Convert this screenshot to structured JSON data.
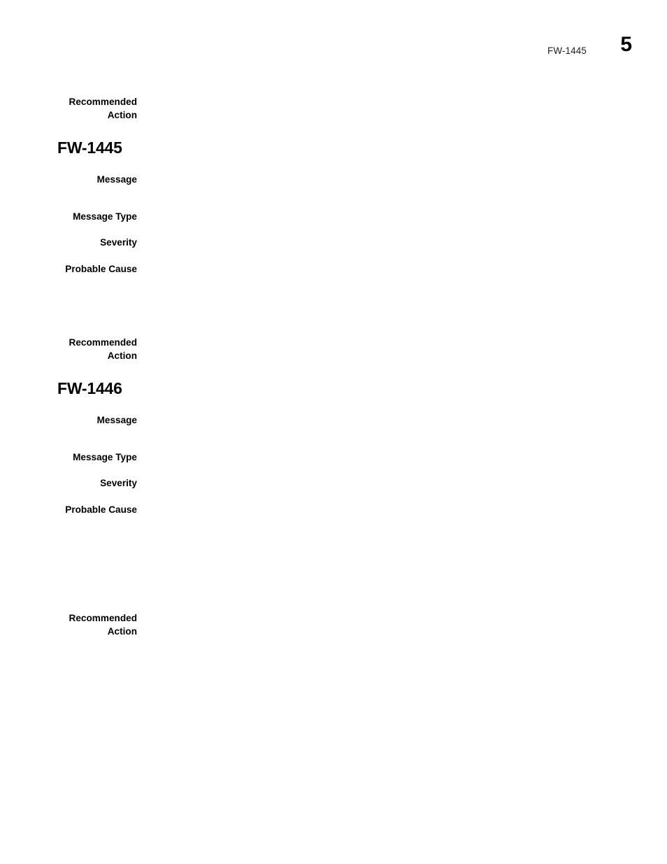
{
  "header": {
    "reference": "FW-1445",
    "page_number": "5"
  },
  "labels": {
    "recommended_action": "Recommended\nAction",
    "message": "Message",
    "message_type": "Message Type",
    "severity": "Severity",
    "probable_cause": "Probable Cause"
  },
  "sections": [
    {
      "continued_recommended_action_value": ""
    },
    {
      "heading": "FW-1445",
      "message_value": "",
      "message_type_value": "",
      "severity_value": "",
      "probable_cause_value": "",
      "recommended_action_value": ""
    },
    {
      "heading": "FW-1446",
      "message_value": "",
      "message_type_value": "",
      "severity_value": "",
      "probable_cause_value": "",
      "recommended_action_value": ""
    }
  ]
}
